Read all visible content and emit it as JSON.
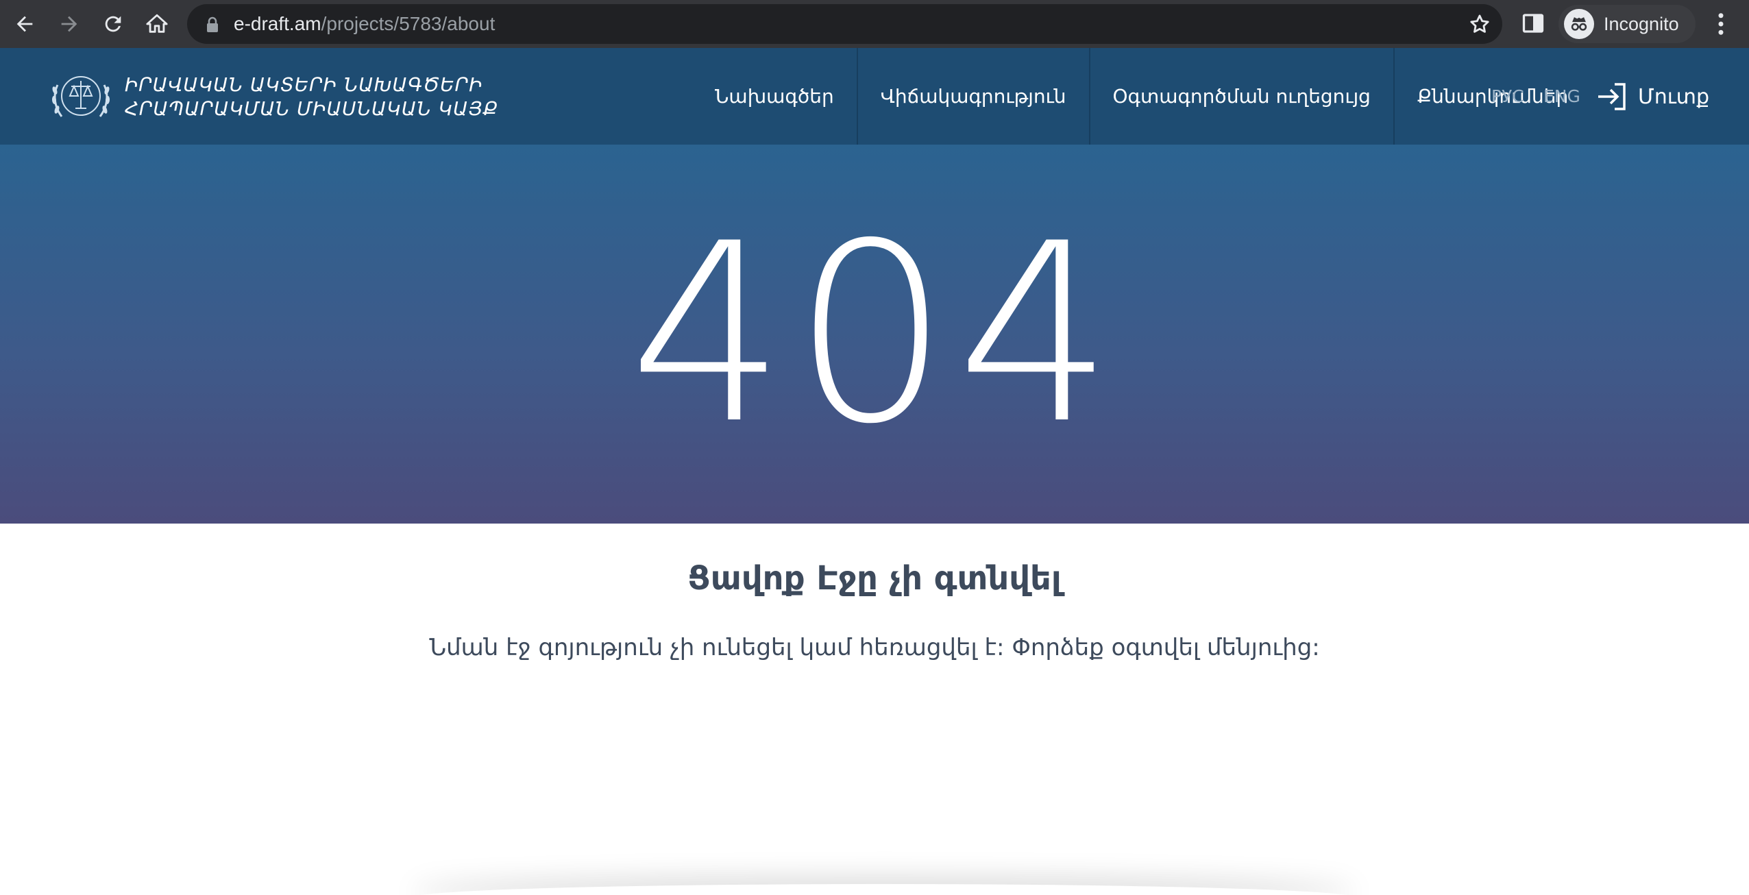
{
  "browser": {
    "url_host": "e-draft.am",
    "url_path": "/projects/5783/about",
    "profile_label": "Incognito",
    "icons": [
      "back-arrow-icon",
      "forward-arrow-icon",
      "reload-icon",
      "home-icon",
      "lock-icon",
      "star-icon",
      "side-panel-icon",
      "incognito-icon",
      "kebab-menu-icon"
    ]
  },
  "site": {
    "logo_line1": "ԻՐԱՎԱԿԱՆ ԱԿՏԵՐԻ ՆԱԽԱԳԾԵՐԻ",
    "logo_line2": "ՀՐԱՊԱՐԱԿՄԱՆ ՄԻԱՍՆԱԿԱՆ ԿԱՅՔ",
    "nav": [
      {
        "label": "Նախագծեր"
      },
      {
        "label": "Վիճակագրություն"
      },
      {
        "label": "Օգտագործման ուղեցույց"
      },
      {
        "label": "Քննարկումներ"
      }
    ],
    "lang_ru": "РУС",
    "lang_en": "ENG",
    "login_label": "Մուտք"
  },
  "error": {
    "code": "404",
    "title": "Ցավոք Էջը չի գտնվել",
    "message": "Նման էջ գոյություն չի ունեցել կամ հեռացվել է: Փորձեք օգտվել մենյուից:"
  },
  "colors": {
    "header_bg": "#1e4c72",
    "hero_top": "#2b6390",
    "hero_bottom": "#4b4c7c",
    "text_dark": "#3d4a5c"
  }
}
